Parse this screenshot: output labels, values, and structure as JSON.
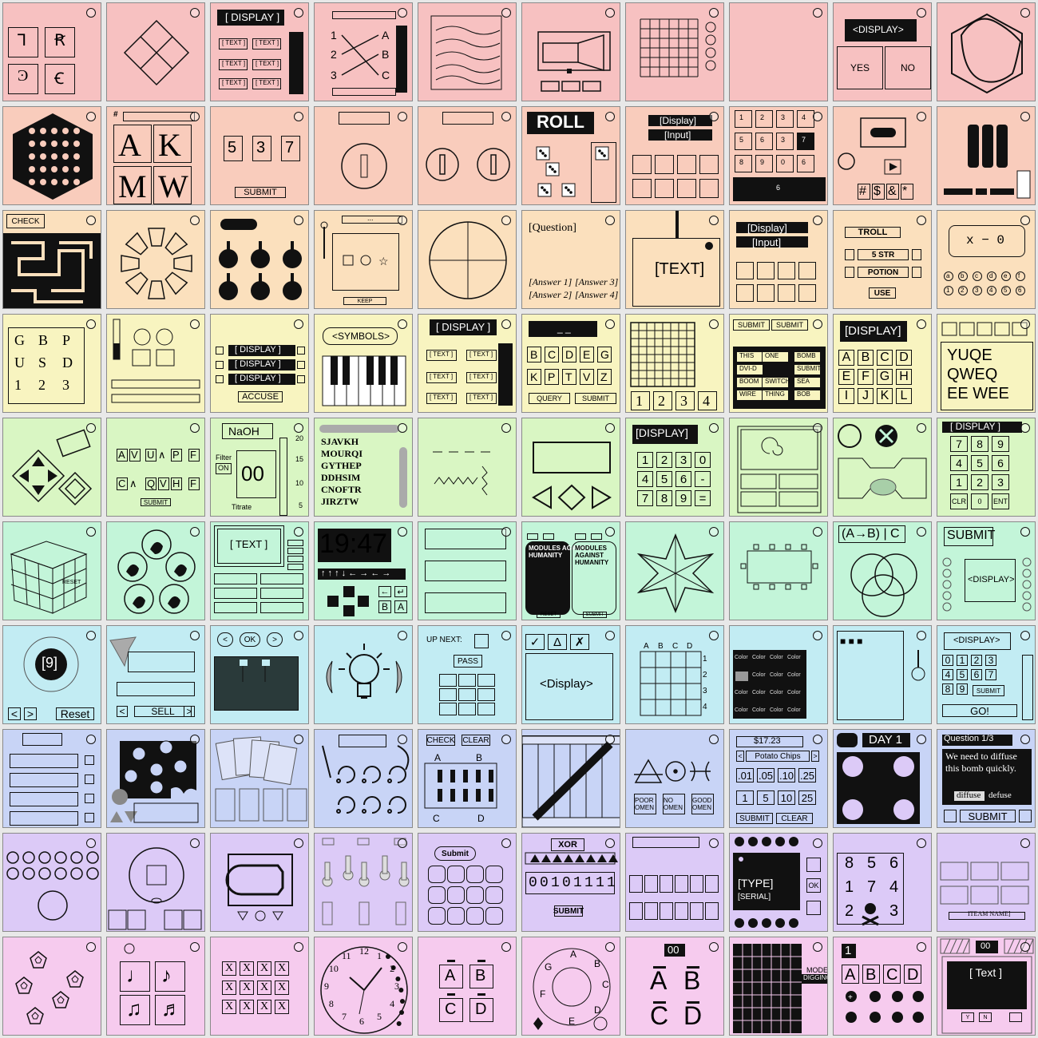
{
  "palette": {
    "row_colors": [
      "#f7c1c1",
      "#f9ccbc",
      "#fbe0bd",
      "#f8f4c0",
      "#d9f6c3",
      "#c3f5d9",
      "#c2ecf3",
      "#c8d4f6",
      "#dccaf7",
      "#f6cbee"
    ],
    "led_border": "#111111"
  },
  "modules": [
    {
      "name": "alphabet-icons",
      "texts": [
        "Ꞁ",
        "Ꞧ",
        "Ͽ",
        "Ꞓ"
      ]
    },
    {
      "name": "diamond-grid",
      "texts": []
    },
    {
      "name": "display-text-module",
      "texts": [
        "[ DISPLAY ]",
        "[ TEXT ]",
        "[ TEXT ]",
        "[ TEXT ]",
        "[ TEXT ]",
        "[ TEXT ]",
        "[ TEXT ]",
        "[ TEXT ]",
        "[ TEXT ]"
      ]
    },
    {
      "name": "wire-abc-module",
      "texts": [
        "1",
        "2",
        "3",
        "A",
        "B",
        "C"
      ]
    },
    {
      "name": "wavy-wires",
      "texts": []
    },
    {
      "name": "maze-box",
      "texts": []
    },
    {
      "name": "grid-dots",
      "texts": []
    },
    {
      "name": "blank-module",
      "texts": []
    },
    {
      "name": "yes-no-module",
      "texts": [
        "<DISPLAY>",
        "YES",
        "NO"
      ]
    },
    {
      "name": "hexagon-map",
      "texts": []
    },
    {
      "name": "hex-maze",
      "texts": []
    },
    {
      "name": "letter-keys",
      "texts": [
        "#",
        "A",
        "K",
        "M",
        "W"
      ]
    },
    {
      "name": "digit-spinners",
      "texts": [
        "5",
        "3",
        "7",
        "SUBMIT"
      ]
    },
    {
      "name": "single-knob",
      "texts": []
    },
    {
      "name": "double-knob",
      "texts": []
    },
    {
      "name": "roll-dice",
      "texts": [
        "ROLL"
      ]
    },
    {
      "name": "display-input-grid",
      "texts": [
        "[Display]",
        "[Input]"
      ]
    },
    {
      "name": "numpad-9",
      "texts": [
        "1",
        "2",
        "3",
        "4",
        "5",
        "6",
        "3",
        "7",
        "8",
        "9",
        "0",
        "6"
      ]
    },
    {
      "name": "cassette",
      "texts": [
        "#",
        "$",
        "&",
        "*"
      ]
    },
    {
      "name": "battery-pack",
      "texts": []
    },
    {
      "name": "maze-check",
      "texts": [
        "CHECK"
      ]
    },
    {
      "name": "octagon-wheel",
      "texts": []
    },
    {
      "name": "six-knobs",
      "texts": []
    },
    {
      "name": "slot-machine",
      "texts": [
        "...",
        "KEEP"
      ]
    },
    {
      "name": "circle-quad",
      "texts": []
    },
    {
      "name": "question-answers",
      "texts": [
        "[Question]",
        "[Answer 1]",
        "[Answer 2]",
        "[Answer 3]",
        "[Answer 4]"
      ]
    },
    {
      "name": "text-display",
      "texts": [
        "[TEXT]"
      ]
    },
    {
      "name": "display-input-grid-2",
      "texts": [
        "[Display]",
        "[Input]"
      ]
    },
    {
      "name": "troll-potion",
      "texts": [
        "TROLL",
        "5 STR",
        "POTION",
        "USE"
      ]
    },
    {
      "name": "equation",
      "texts": [
        "x − 0",
        "a",
        "b",
        "c",
        "d",
        "e",
        "f",
        "1",
        "2",
        "3",
        "4",
        "5",
        "6"
      ]
    },
    {
      "name": "letter-grid-gbp",
      "texts": [
        "G",
        "B",
        "P",
        "U",
        "S",
        "D",
        "1",
        "2",
        "3"
      ]
    },
    {
      "name": "sliders",
      "texts": []
    },
    {
      "name": "accuse",
      "texts": [
        "[ DISPLAY ]",
        "[ DISPLAY ]",
        "[ DISPLAY ]",
        "ACCUSE"
      ]
    },
    {
      "name": "piano",
      "texts": [
        "<SYMBOLS>"
      ]
    },
    {
      "name": "display-text-2",
      "texts": [
        "[ DISPLAY ]",
        "[ TEXT ]",
        "[ TEXT ]",
        "[ TEXT ]",
        "[ TEXT ]",
        "[ TEXT ]",
        "[ TEXT ]"
      ]
    },
    {
      "name": "letter-query",
      "texts": [
        "_ _",
        "B",
        "C",
        "D",
        "E",
        "G",
        "K",
        "P",
        "T",
        "V",
        "Z",
        "QUERY",
        "SUBMIT"
      ]
    },
    {
      "name": "grid-1234",
      "texts": [
        "1",
        "2",
        "3",
        "4"
      ]
    },
    {
      "name": "word-buttons",
      "texts": [
        "SUBMIT",
        "SUBMIT",
        "THIS",
        "ONE",
        "BOMB",
        "DVI-D",
        "SUBMIT",
        "BOOM",
        "SWITCH",
        "SEA",
        "WIRE",
        "THING",
        "BOB"
      ]
    },
    {
      "name": "display-letters",
      "texts": [
        "[DISPLAY]",
        "A",
        "B",
        "C",
        "D",
        "E",
        "F",
        "G",
        "H",
        "I",
        "J",
        "K",
        "L"
      ]
    },
    {
      "name": "yuqe",
      "texts": [
        "YUQE",
        "QWEQ",
        "EE WEE"
      ]
    },
    {
      "name": "arrow-diamonds",
      "texts": []
    },
    {
      "name": "logic-letters",
      "texts": [
        "A",
        "V",
        "U",
        "∧",
        "P",
        "F",
        "C",
        "∧",
        "Q",
        "V",
        "H",
        "F",
        "SUBMIT"
      ]
    },
    {
      "name": "chemistry",
      "texts": [
        "NaOH",
        "Filter",
        "ON",
        "00",
        "Titrate",
        "20",
        "15",
        "10",
        "5"
      ]
    },
    {
      "name": "word-search",
      "texts": [
        "SJAVKH",
        "MOURQI",
        "GYTHEP",
        "DDHSIM",
        "CNOFTR",
        "JIRZTW"
      ]
    },
    {
      "name": "morse-waves",
      "texts": []
    },
    {
      "name": "shape-arrows",
      "texts": []
    },
    {
      "name": "calculator",
      "texts": [
        "[DISPLAY]",
        "1",
        "2",
        "3",
        "0",
        "4",
        "5",
        "6",
        "-",
        "7",
        "8",
        "9",
        "="
      ]
    },
    {
      "name": "snail",
      "texts": []
    },
    {
      "name": "circle-switch",
      "texts": []
    },
    {
      "name": "keypad-display",
      "texts": [
        "[ DISPLAY ]",
        "7",
        "8",
        "9",
        "4",
        "5",
        "6",
        "1",
        "2",
        "3",
        "CLR",
        "0",
        "ENT"
      ]
    },
    {
      "name": "rubik-cube",
      "texts": [
        "RESET"
      ]
    },
    {
      "name": "hand-signs",
      "texts": []
    },
    {
      "name": "text-screen",
      "texts": [
        "[ TEXT ]"
      ]
    },
    {
      "name": "clock-1947",
      "texts": [
        "19:47",
        "↑ ↑ ↑ ↓ ← → ← →",
        "←",
        "↵",
        "B",
        "A"
      ]
    },
    {
      "name": "three-bars",
      "texts": []
    },
    {
      "name": "modules-against-humanity",
      "texts": [
        "MODULES AGAINST HUMANITY",
        "MODULES AGAINST HUMANITY",
        "RESET",
        "SUBMIT"
      ]
    },
    {
      "name": "star-shape",
      "texts": []
    },
    {
      "name": "board-rect",
      "texts": []
    },
    {
      "name": "venn",
      "texts": [
        "(A→B) | C"
      ]
    },
    {
      "name": "submit-display",
      "texts": [
        "SUBMIT",
        "<DISPLAY>"
      ]
    },
    {
      "name": "number-ball",
      "texts": [
        "[9]",
        "<",
        ">",
        "Reset"
      ]
    },
    {
      "name": "funnel-sell",
      "texts": [
        "<",
        "SELL",
        ">"
      ]
    },
    {
      "name": "ok-screen",
      "texts": [
        "<",
        "OK",
        ">"
      ]
    },
    {
      "name": "lightbulb",
      "texts": []
    },
    {
      "name": "up-next",
      "texts": [
        "UP NEXT:",
        "PASS"
      ]
    },
    {
      "name": "display-symbols",
      "texts": [
        "✓",
        "Δ",
        "✗",
        "<Display>"
      ]
    },
    {
      "name": "squiggle-grid",
      "texts": [
        "A",
        "B",
        "C",
        "D",
        "1",
        "2",
        "3",
        "4"
      ]
    },
    {
      "name": "color-grid",
      "texts": [
        "Color"
      ]
    },
    {
      "name": "dots-switch",
      "texts": [
        "■ ■ ■"
      ]
    },
    {
      "name": "number-go",
      "texts": [
        "<DISPLAY>",
        "0",
        "1",
        "2",
        "3",
        "4",
        "5",
        "6",
        "7",
        "8",
        "9",
        "SUBMIT",
        "GO!"
      ]
    },
    {
      "name": "bars-checkboxes",
      "texts": []
    },
    {
      "name": "cookie-dots",
      "texts": []
    },
    {
      "name": "cards",
      "texts": []
    },
    {
      "name": "hooks-wires",
      "texts": []
    },
    {
      "name": "check-clear-wires",
      "texts": [
        "CHECK",
        "CLEAR",
        "A",
        "B",
        "C",
        "D"
      ]
    },
    {
      "name": "crate",
      "texts": []
    },
    {
      "name": "omens",
      "texts": [
        "POOR OMEN",
        "NO OMEN",
        "GOOD OMEN"
      ]
    },
    {
      "name": "shop",
      "texts": [
        "$17.23",
        "<",
        "Potato Chips",
        ">",
        ".01",
        ".05",
        ".10",
        ".25",
        "1",
        "5",
        "10",
        "25",
        "SUBMIT",
        "CLEAR"
      ]
    },
    {
      "name": "day-dice",
      "texts": [
        "DAY 1"
      ]
    },
    {
      "name": "diffuse-quiz",
      "texts": [
        "Question 1/3",
        "We need to diffuse this bomb quickly.",
        "diffuse",
        "defuse",
        "SUBMIT"
      ]
    },
    {
      "name": "circle-buttons",
      "texts": []
    },
    {
      "name": "square-circle",
      "texts": []
    },
    {
      "name": "shape-buttons",
      "texts": []
    },
    {
      "name": "toggle-switches",
      "texts": []
    },
    {
      "name": "submit-keys",
      "texts": [
        "Submit"
      ]
    },
    {
      "name": "xor-binary",
      "texts": [
        "XOR",
        "0",
        "0",
        "1",
        "0",
        "1",
        "1",
        "1",
        "1",
        "SUBMIT"
      ]
    },
    {
      "name": "empty-boxes",
      "texts": []
    },
    {
      "name": "type-serial",
      "texts": [
        "[TYPE]",
        "[SERIAL]",
        "OK"
      ]
    },
    {
      "name": "skull-grid",
      "texts": [
        "8",
        "5",
        "6",
        "1",
        "7",
        "4",
        "2",
        "3"
      ]
    },
    {
      "name": "hieroglyphs",
      "texts": [
        "ITEAM NAME]"
      ]
    },
    {
      "name": "pentagons",
      "texts": []
    },
    {
      "name": "music-notes",
      "texts": [
        "♩",
        "♪",
        "♫",
        "♬"
      ]
    },
    {
      "name": "x-grid",
      "texts": [
        "X"
      ]
    },
    {
      "name": "clock-face",
      "texts": [
        "12",
        "1",
        "2",
        "3",
        "4",
        "5",
        "6",
        "7",
        "8",
        "9",
        "10",
        "11"
      ]
    },
    {
      "name": "abcd-keys",
      "texts": [
        "A",
        "B",
        "C",
        "D"
      ]
    },
    {
      "name": "letter-wheel",
      "texts": [
        "A",
        "B",
        "C",
        "D",
        "E",
        "F",
        "G"
      ]
    },
    {
      "name": "abcd-bars",
      "texts": [
        "00",
        "A",
        "B",
        "C",
        "D"
      ]
    },
    {
      "name": "digging",
      "texts": [
        "MODE",
        "DIGGING"
      ]
    },
    {
      "name": "abcd-dots",
      "texts": [
        "1",
        "A",
        "B",
        "C",
        "D"
      ]
    },
    {
      "name": "text-terminal",
      "texts": [
        "00",
        "[ Text ]",
        "Y",
        "N"
      ]
    }
  ]
}
